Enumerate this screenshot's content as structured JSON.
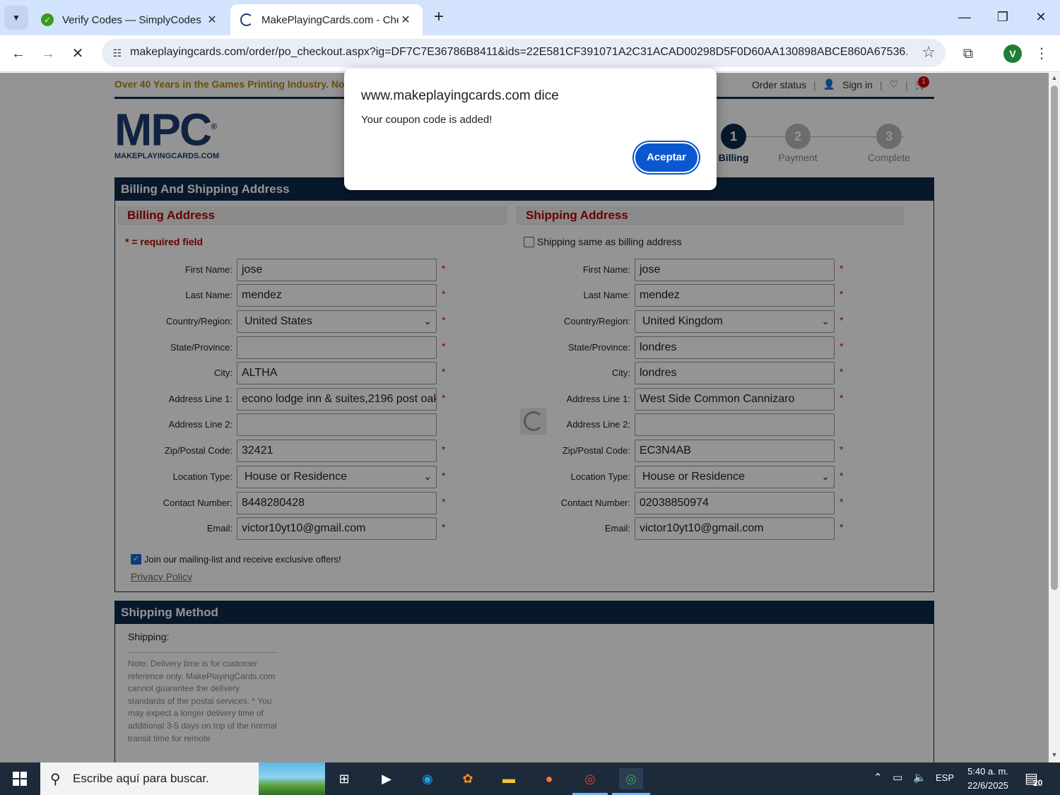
{
  "browser": {
    "tabs": [
      {
        "title": "Verify Codes — SimplyCodes",
        "favicon_color": "#3c9a1e"
      },
      {
        "title": "MakePlayingCards.com - Checkout",
        "favicon_color": "#1c3d6e"
      }
    ],
    "url": "makeplayingcards.com/order/po_checkout.aspx?ig=DF7C7E36786B8411&ids=22E581CF391071A2C31ACAD00298D5F0D60AA130898ABCE860A67536...",
    "avatar_letter": "V"
  },
  "header": {
    "tagline": "Over 40 Years in the Games Printing Industry. No",
    "order_status": "Order status",
    "sign_in": "Sign in",
    "cart_count": "1",
    "logo_text": "MPC",
    "logo_sub": "MAKEPLAYINGCARDS.COM",
    "registered": "®"
  },
  "steps": [
    {
      "num": "1",
      "label": "Billing",
      "active": true
    },
    {
      "num": "2",
      "label": "Payment",
      "active": false
    },
    {
      "num": "3",
      "label": "Complete",
      "active": false
    }
  ],
  "address_section": {
    "title": "Billing And Shipping Address",
    "billing_title": "Billing Address",
    "shipping_title": "Shipping Address",
    "required_note": "* = required field",
    "same_as_billing": "Shipping same as billing address",
    "labels": [
      "First Name:",
      "Last Name:",
      "Country/Region:",
      "State/Province:",
      "City:",
      "Address Line 1:",
      "Address Line 2:",
      "Zip/Postal Code:",
      "Location Type:",
      "Contact Number:",
      "Email:"
    ],
    "billing": [
      "jose",
      "mendez",
      "United States",
      "",
      "ALTHA",
      "econo lodge inn & suites,2196 post oak",
      "",
      "32421",
      "House or Residence",
      "8448280428",
      "victor10yt10@gmail.com"
    ],
    "shipping": [
      "jose",
      "mendez",
      "United Kingdom",
      "londres",
      "londres",
      "West Side Common Cannizaro",
      "",
      "EC3N4AB",
      "House or Residence",
      "02038850974",
      "victor10yt10@gmail.com"
    ],
    "mailing_list": "Join our mailing-list and receive exclusive offers!",
    "privacy_policy": "Privacy Policy"
  },
  "shipping_method": {
    "title": "Shipping Method",
    "label": "Shipping:",
    "note": "Note: Delivery time is for customer reference only. MakePlayingCards.com cannot guarantee the delivery standards of the postal services. * You may expect a longer delivery time of additional 3-5 days on top of the normal transit time for remote"
  },
  "dialog": {
    "title": "www.makeplayingcards.com dice",
    "message": "Your coupon code is added!",
    "button": "Aceptar"
  },
  "taskbar": {
    "search_placeholder": "Escribe aquí para buscar.",
    "language": "ESP",
    "time": "5:40 a. m.",
    "date": "22/6/2025",
    "notifications": "20"
  }
}
